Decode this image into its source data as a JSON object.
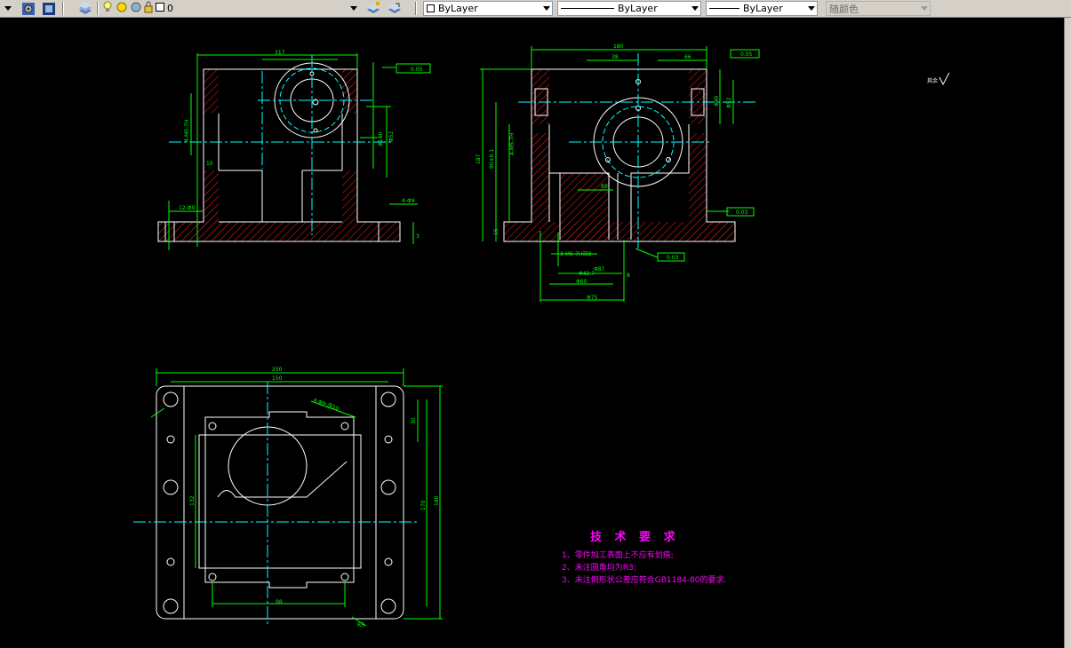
{
  "toolbar": {
    "layer_value": "0",
    "color_value": "ByLayer",
    "linetype_value": "ByLayer",
    "lineweight_value": "ByLayer",
    "plotstyle_value": "随颜色",
    "icons": [
      "dropdown-arrow-icon",
      "workspace-settings-icon",
      "toolbox-icon",
      "layer-properties-icon",
      "bulb-icon",
      "sun-icon",
      "freeze-icon",
      "lock-icon",
      "layer-color-square-icon",
      "make-current-icon",
      "layer-previous-icon"
    ]
  },
  "drawing": {
    "view1": {
      "dim_top": "317",
      "dim_right_1": "0.05",
      "dim_right_2": "Φ52",
      "dim_right_3": "Φ140",
      "dim_right_4": "10",
      "dim_left_1": "4-M5-7H",
      "dim_left_2": "12-Φ9",
      "dim_small": "3",
      "dim_hole": "4-Φ9",
      "tol_box": "0.05"
    },
    "view2": {
      "dim_top": "180",
      "dim_top_2": "38",
      "dim_top_3": "66",
      "tol_top": "0.05",
      "dim_left_1": "187",
      "dim_left_2": "90±0.1",
      "dim_left_3": "4-M5-7H",
      "dim_left_4": "15",
      "dim_right_1": "Φ40",
      "dim_right_2": "Φ52",
      "dim_mid": "R5",
      "dim_bottom_1": "3-M5-7H深8",
      "dim_bottom_2": "Φ42.7",
      "dim_bottom_3": "Φ60",
      "dim_bottom_4": "Φ75",
      "dim_bottom_5": "Φ87",
      "dim_bottom_6": "8",
      "tol_1": "0.03",
      "tol_2": "0.03"
    },
    "view3": {
      "dim_top_1": "250",
      "dim_top_2": "150",
      "dim_hole": "4-Φ9-深10",
      "dim_right_1": "30",
      "dim_right_2": "170",
      "dim_right_3": "180",
      "dim_left": "132",
      "dim_bottom": "98",
      "dim_r": "R5"
    },
    "misc_marker": "其余"
  },
  "tech_req": {
    "title": "技 术 要 求",
    "lines": [
      "1、零件加工表面上不应有划痕;",
      "2、未注圆角均为R3;",
      "3、未注倒形状公差应符合GB1184-80的要求."
    ]
  },
  "colors": {
    "background": "#000000",
    "outline": "#ffffff",
    "dimension": "#00ff00",
    "centerline": "#00ffff",
    "section": "#ff0000",
    "text": "#ff00ff",
    "toolbar": "#d4d0c8"
  }
}
